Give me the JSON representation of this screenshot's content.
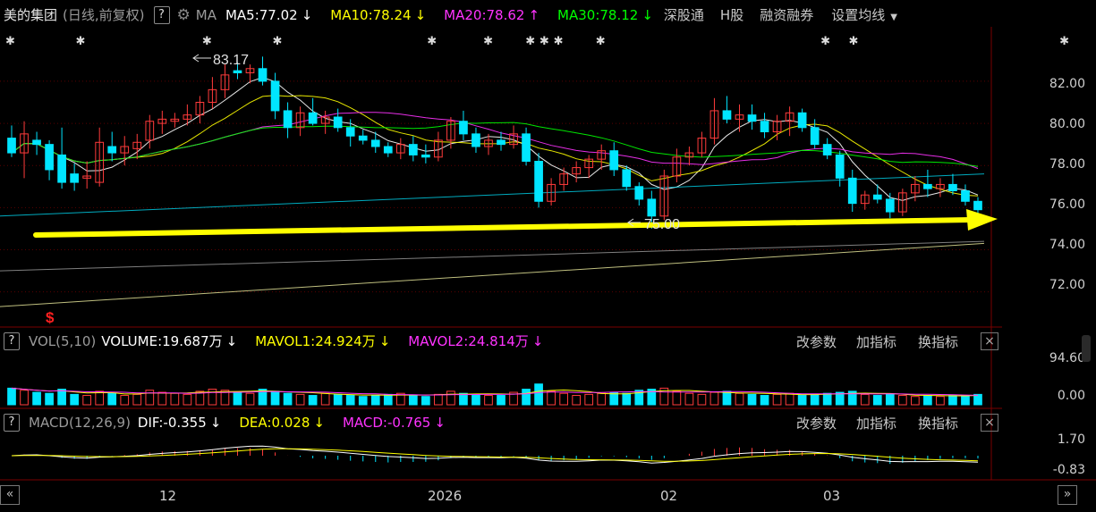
{
  "header": {
    "stock_name": "美的集团",
    "period": "(日线,前复权)",
    "help_label": "?",
    "ma_label": "MA",
    "ma5": "MA5:77.02",
    "ma10": "MA10:78.24",
    "ma20": "MA20:78.62",
    "ma30": "MA30:78.12",
    "arrow_down": "↓",
    "arrow_up": "↑",
    "link_sz": "深股通",
    "link_h": "H股",
    "link_margin": "融资融券",
    "link_settings": "设置均线",
    "dropdown_icon": "caret-down-icon",
    "settings_icon": "gear-icon"
  },
  "colors": {
    "up": "#ff3b3b",
    "down": "#00e5ff",
    "ma5": "#ffffff",
    "ma10": "#ffff00",
    "ma20": "#ff33ff",
    "ma30": "#00ff00",
    "trend_arrow": "#ffff00"
  },
  "price_panel": {
    "high_marker": "83.17",
    "low_marker": "75.00",
    "y_ticks": [
      "82.00",
      "80.00",
      "78.00",
      "76.00",
      "74.00",
      "72.00"
    ],
    "event_marker": "$",
    "star_glyph": "✱"
  },
  "volume_panel": {
    "help_label": "?",
    "name": "VOL(5,10)",
    "volume": "VOLUME:19.687万",
    "mavol1": "MAVOL1:24.924万",
    "mavol2": "MAVOL2:24.814万",
    "arrow_down": "↓",
    "btn_params": "改参数",
    "btn_add": "加指标",
    "btn_switch": "换指标",
    "close_label": "×",
    "y_ticks": [
      "94.60",
      "0.00"
    ]
  },
  "macd_panel": {
    "help_label": "?",
    "name": "MACD(12,26,9)",
    "dif": "DIF:-0.355",
    "dea": "DEA:0.028",
    "macd": "MACD:-0.765",
    "arrow_down": "↓",
    "btn_params": "改参数",
    "btn_add": "加指标",
    "btn_switch": "换指标",
    "close_label": "×",
    "y_ticks": [
      "1.70",
      "-0.83"
    ]
  },
  "x_axis": {
    "labels": [
      "12",
      "2026",
      "02",
      "03"
    ],
    "nav_left": "«",
    "nav_right": "»"
  },
  "chart_data": {
    "type": "candlestick",
    "y_range": [
      70.5,
      84.5
    ],
    "candles": [
      [
        79.3,
        79.9,
        78.4,
        78.6
      ],
      [
        78.6,
        80.1,
        77.4,
        79.5
      ],
      [
        79.2,
        79.6,
        78.5,
        79.0
      ],
      [
        79.0,
        79.2,
        77.3,
        77.8
      ],
      [
        78.5,
        79.8,
        76.9,
        77.2
      ],
      [
        77.6,
        78.1,
        76.8,
        77.2
      ],
      [
        77.4,
        78.2,
        76.9,
        77.5
      ],
      [
        77.2,
        79.8,
        77.0,
        79.1
      ],
      [
        78.9,
        79.6,
        78.2,
        78.6
      ],
      [
        78.6,
        79.4,
        78.0,
        78.9
      ],
      [
        78.8,
        79.5,
        78.3,
        79.1
      ],
      [
        79.2,
        80.4,
        78.8,
        80.1
      ],
      [
        80.0,
        80.6,
        79.5,
        80.2
      ],
      [
        80.1,
        80.5,
        79.8,
        80.2
      ],
      [
        80.2,
        80.9,
        79.9,
        80.4
      ],
      [
        80.4,
        81.3,
        80.0,
        81.0
      ],
      [
        81.0,
        82.2,
        80.7,
        81.6
      ],
      [
        81.6,
        82.8,
        81.2,
        82.3
      ],
      [
        82.5,
        82.9,
        82.1,
        82.4
      ],
      [
        82.4,
        82.8,
        81.9,
        82.6
      ],
      [
        82.6,
        83.17,
        81.8,
        82.0
      ],
      [
        82.0,
        82.4,
        80.2,
        80.6
      ],
      [
        80.6,
        81.0,
        79.3,
        79.8
      ],
      [
        79.8,
        80.8,
        79.4,
        80.5
      ],
      [
        80.5,
        81.2,
        79.9,
        80.0
      ],
      [
        80.0,
        80.6,
        79.5,
        80.3
      ],
      [
        80.3,
        80.7,
        79.6,
        79.8
      ],
      [
        79.8,
        80.2,
        78.9,
        79.4
      ],
      [
        79.4,
        79.7,
        79.0,
        79.2
      ],
      [
        79.2,
        79.6,
        78.6,
        78.9
      ],
      [
        78.9,
        79.1,
        78.4,
        78.6
      ],
      [
        78.6,
        79.3,
        78.3,
        79.0
      ],
      [
        79.0,
        79.4,
        78.2,
        78.5
      ],
      [
        78.5,
        79.0,
        78.1,
        78.4
      ],
      [
        78.4,
        79.6,
        78.2,
        79.2
      ],
      [
        79.2,
        80.3,
        78.8,
        80.1
      ],
      [
        80.1,
        80.6,
        79.2,
        79.5
      ],
      [
        79.5,
        79.8,
        78.6,
        78.9
      ],
      [
        78.9,
        79.5,
        78.5,
        79.2
      ],
      [
        79.2,
        79.6,
        78.7,
        79.0
      ],
      [
        79.0,
        79.9,
        78.8,
        79.5
      ],
      [
        79.5,
        79.8,
        78.0,
        78.2
      ],
      [
        78.2,
        78.6,
        76.0,
        76.3
      ],
      [
        76.3,
        77.4,
        76.1,
        77.1
      ],
      [
        77.1,
        77.9,
        76.8,
        77.6
      ],
      [
        77.6,
        78.2,
        77.2,
        77.9
      ],
      [
        77.9,
        78.5,
        77.4,
        78.3
      ],
      [
        78.3,
        79.0,
        77.8,
        78.7
      ],
      [
        78.7,
        79.1,
        77.5,
        77.8
      ],
      [
        77.8,
        78.0,
        76.8,
        77.0
      ],
      [
        77.0,
        77.2,
        76.1,
        76.4
      ],
      [
        76.4,
        76.8,
        75.0,
        75.6
      ],
      [
        75.6,
        77.8,
        75.4,
        77.5
      ],
      [
        77.5,
        78.8,
        77.2,
        78.4
      ],
      [
        78.4,
        78.9,
        78.0,
        78.6
      ],
      [
        78.6,
        79.6,
        78.4,
        79.3
      ],
      [
        79.3,
        81.2,
        79.0,
        80.6
      ],
      [
        80.6,
        81.3,
        80.0,
        80.2
      ],
      [
        80.2,
        80.9,
        79.6,
        80.4
      ],
      [
        80.4,
        80.9,
        79.7,
        80.1
      ],
      [
        80.1,
        80.5,
        79.3,
        79.6
      ],
      [
        79.6,
        80.4,
        79.2,
        80.1
      ],
      [
        80.1,
        80.8,
        79.4,
        80.5
      ],
      [
        80.5,
        80.7,
        79.6,
        79.8
      ],
      [
        79.8,
        80.2,
        78.8,
        79.0
      ],
      [
        79.0,
        79.3,
        78.3,
        78.5
      ],
      [
        78.5,
        78.7,
        77.0,
        77.4
      ],
      [
        77.4,
        77.8,
        75.8,
        76.2
      ],
      [
        76.2,
        76.8,
        75.9,
        76.6
      ],
      [
        76.6,
        77.1,
        76.2,
        76.4
      ],
      [
        76.4,
        76.7,
        75.5,
        75.8
      ],
      [
        75.8,
        76.9,
        75.6,
        76.7
      ],
      [
        76.7,
        77.5,
        76.3,
        77.1
      ],
      [
        77.1,
        77.8,
        76.5,
        76.9
      ],
      [
        76.9,
        77.4,
        76.5,
        77.1
      ],
      [
        77.1,
        77.6,
        76.6,
        76.8
      ],
      [
        76.8,
        77.1,
        76.1,
        76.3
      ],
      [
        76.3,
        76.5,
        75.7,
        75.9
      ]
    ],
    "volume_max": 94.6,
    "volumes": [
      32,
      28,
      24,
      22,
      30,
      20,
      18,
      26,
      22,
      18,
      20,
      28,
      24,
      22,
      20,
      26,
      30,
      28,
      24,
      22,
      30,
      26,
      22,
      20,
      18,
      22,
      20,
      18,
      16,
      18,
      20,
      22,
      18,
      16,
      20,
      26,
      22,
      20,
      18,
      18,
      24,
      30,
      40,
      26,
      22,
      18,
      20,
      22,
      24,
      22,
      28,
      30,
      32,
      26,
      22,
      20,
      24,
      26,
      22,
      20,
      18,
      20,
      22,
      18,
      20,
      22,
      24,
      26,
      20,
      18,
      20,
      18,
      16,
      18,
      16,
      18,
      18,
      20
    ]
  }
}
